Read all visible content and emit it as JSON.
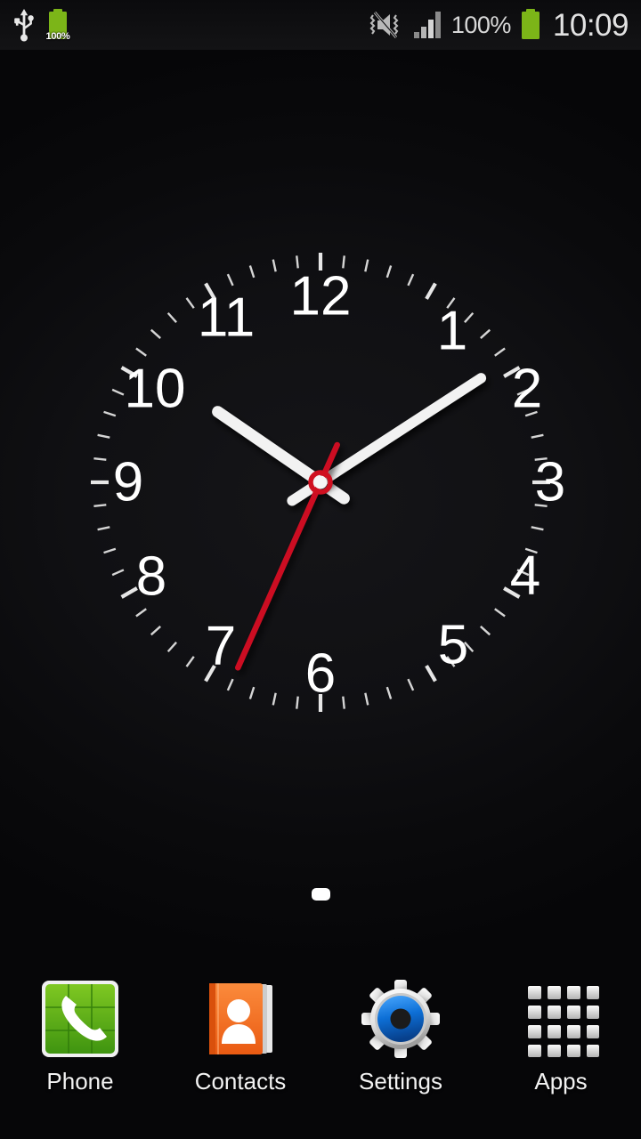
{
  "status_bar": {
    "left_icons": [
      {
        "name": "usb-icon",
        "label": "USB connected"
      },
      {
        "name": "battery-charging-icon",
        "label": "100%"
      }
    ],
    "battery_overlay_text": "100%",
    "mute_vibrate_icon": "mute-vibrate-icon",
    "signal_icon": "signal-bars-icon",
    "battery_percent": "100%",
    "battery_icon": "battery-full-icon",
    "time": "10:09",
    "colors": {
      "battery_green": "#7cb518",
      "text": "#dedede",
      "bar_bg": "#0f0f11"
    }
  },
  "wallpaper": {
    "background_color": "#0a0a0c"
  },
  "clock_widget": {
    "name": "analog-clock-widget",
    "numerals": [
      "12",
      "1",
      "2",
      "3",
      "4",
      "5",
      "6",
      "7",
      "8",
      "9",
      "10",
      "11"
    ],
    "displayed_time": "10:09",
    "hour_value": 10,
    "minute_value": 9,
    "second_value": 34,
    "hour_hand_angle_deg": 304.5,
    "minute_hand_angle_deg": 57,
    "second_hand_angle_deg": 204,
    "colors": {
      "dial_text": "#ffffff",
      "tick": "#e8e8e8",
      "hour_hand": "#f2f2f2",
      "minute_hand": "#f2f2f2",
      "second_hand": "#cc1122",
      "hub": "#d01020"
    },
    "minute_ticks": 60
  },
  "page_indicator": {
    "name": "home-page-indicator",
    "total_pages": 1,
    "active_page": 1
  },
  "dock": {
    "items": [
      {
        "name": "dock-item-phone",
        "label": "Phone",
        "icon": "phone-handset-icon",
        "color": "#5cb11c"
      },
      {
        "name": "dock-item-contacts",
        "label": "Contacts",
        "icon": "contacts-book-icon",
        "color": "#f26722"
      },
      {
        "name": "dock-item-settings",
        "label": "Settings",
        "icon": "gear-icon",
        "color": "#1578d8"
      },
      {
        "name": "dock-item-apps",
        "label": "Apps",
        "icon": "apps-grid-icon",
        "color": "#e4e4e4"
      }
    ]
  }
}
